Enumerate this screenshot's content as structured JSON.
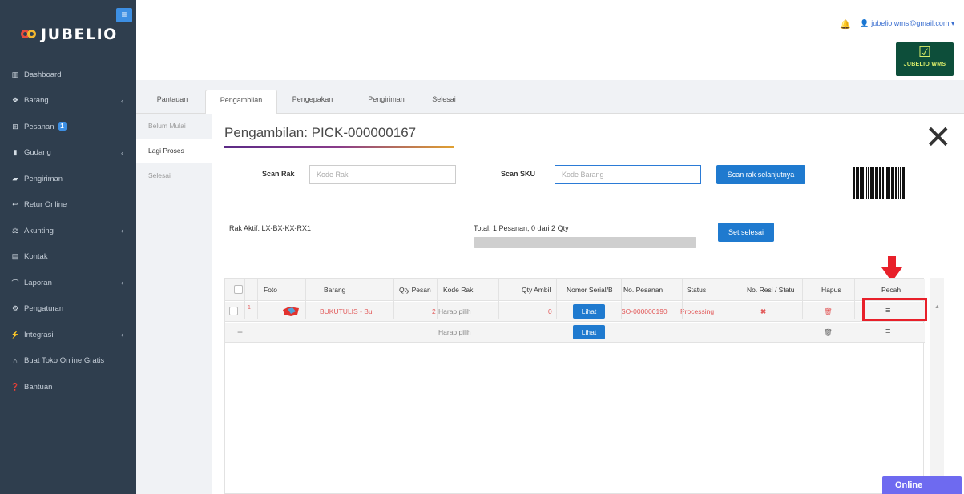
{
  "brand": {
    "name": "JUBELIO",
    "menu_icon": "hamburger-icon"
  },
  "sidebar": {
    "items": [
      {
        "label": "Dashboard",
        "icon": "chart-icon",
        "chevron": false
      },
      {
        "label": "Barang",
        "icon": "box-icon",
        "chevron": true
      },
      {
        "label": "Pesanan",
        "icon": "cart-icon",
        "chevron": false,
        "badge": "1"
      },
      {
        "label": "Gudang",
        "icon": "warehouse-icon",
        "chevron": true
      },
      {
        "label": "Pengiriman",
        "icon": "truck-icon",
        "chevron": false
      },
      {
        "label": "Retur Online",
        "icon": "reply-icon",
        "chevron": false
      },
      {
        "label": "Akunting",
        "icon": "scale-icon",
        "chevron": true
      },
      {
        "label": "Kontak",
        "icon": "contact-icon",
        "chevron": false
      },
      {
        "label": "Laporan",
        "icon": "line-chart-icon",
        "chevron": true
      },
      {
        "label": "Pengaturan",
        "icon": "gears-icon",
        "chevron": false
      },
      {
        "label": "Integrasi",
        "icon": "plug-icon",
        "chevron": true
      },
      {
        "label": "Buat Toko Online Gratis",
        "icon": "store-icon",
        "chevron": false
      },
      {
        "label": "Bantuan",
        "icon": "question-icon",
        "chevron": false
      }
    ]
  },
  "topbar": {
    "user_email": "jubelio.wms@gmail.com",
    "wms_logo_text": "JUBELIO WMS"
  },
  "tabs": [
    "Pantauan",
    "Pengambilan",
    "Pengepakan",
    "Pengiriman",
    "Selesai"
  ],
  "active_tab": "Pengambilan",
  "subnav": [
    "Belum Mulai",
    "Lagi Proses",
    "Selesai"
  ],
  "active_subnav": "Lagi Proses",
  "panel": {
    "title": "Pengambilan: PICK-000000167",
    "scan_rak_label": "Scan Rak",
    "scan_rak_placeholder": "Kode Rak",
    "scan_sku_label": "Scan SKU",
    "scan_sku_placeholder": "Kode Barang",
    "next_rack_button": "Scan rak selanjutnya",
    "active_rack": "Rak Aktif: LX-BX-KX-RX1",
    "total": "Total: 1 Pesanan, 0 dari 2 Qty",
    "progress": 0,
    "set_done_button": "Set selesai"
  },
  "table": {
    "columns": [
      "Foto",
      "Barang",
      "Qty Pesan",
      "Kode Rak",
      "Qty Ambil",
      "Nomor Serial/B",
      "No. Pesanan",
      "Status",
      "No. Resi / Statu",
      "Hapus",
      "Pecah"
    ],
    "rows": [
      {
        "no": "1",
        "barang": "BUKUTULIS - Bu",
        "qty_pesan": "2",
        "kode_rak": "Harap pilih",
        "qty_ambil": "0",
        "serial_button": "Lihat",
        "no_pesanan": "SO-000000190",
        "status": "Processing"
      }
    ],
    "new_row": {
      "add_icon": "+",
      "kode_rak": "Harap pilih",
      "serial_button": "Lihat"
    }
  },
  "online_label": "Online",
  "colors": {
    "sidebar": "#2f3e4e",
    "primary": "#1f7acf",
    "highlight": "#e8202a",
    "online": "#6e6af0"
  }
}
